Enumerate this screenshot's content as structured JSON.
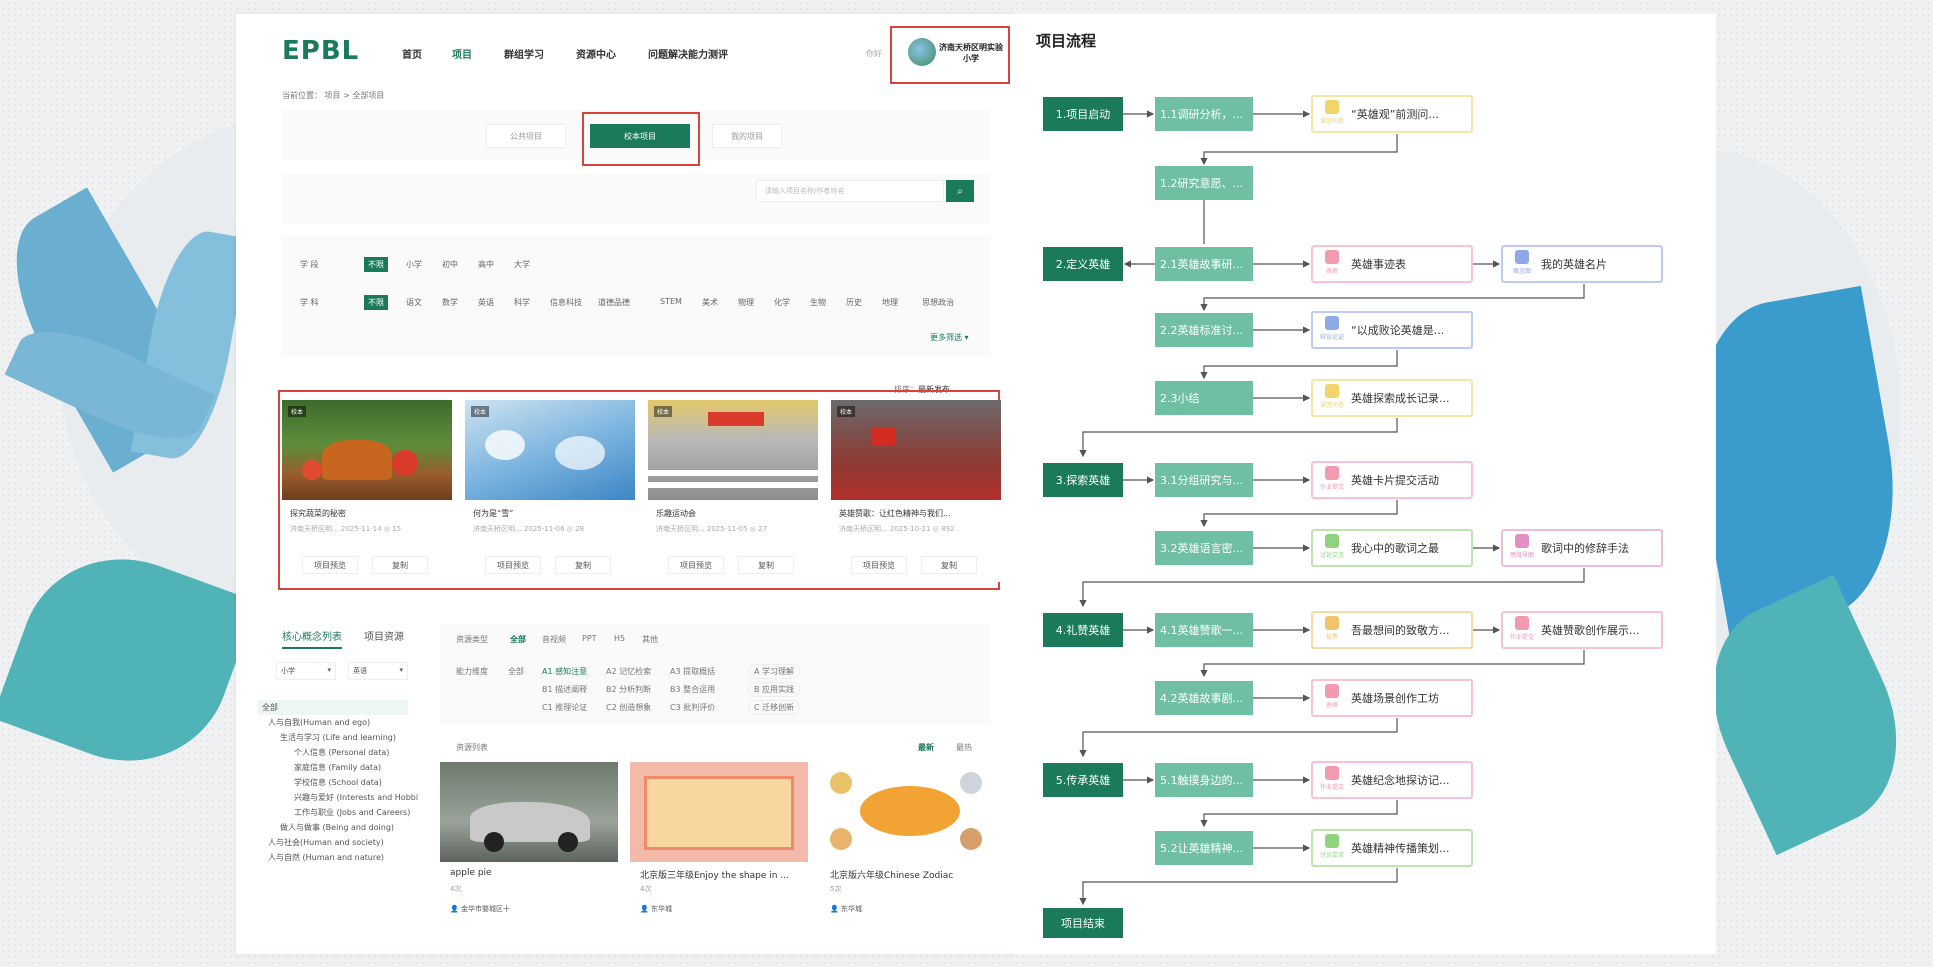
{
  "header": {
    "logo": "EPBL",
    "nav": [
      "首页",
      "项目",
      "群组学习",
      "资源中心",
      "问题解决能力测评"
    ],
    "active_nav": "项目",
    "user_name": "济南天桥区明实验小学",
    "user_prefix": "你好"
  },
  "breadcrumb": "当前位置：  项目  >  全部项目",
  "project_tabs": [
    "公共项目",
    "校本项目",
    "我的项目"
  ],
  "selected_tab": "校本项目",
  "search": {
    "placeholder": "请输入项目名称/作者姓名"
  },
  "filters": {
    "stage_label": "学    段",
    "stage_options": [
      "不限",
      "小学",
      "初中",
      "高中",
      "大学"
    ],
    "subject_label": "学    科",
    "subject_options": [
      "不限",
      "语文",
      "数学",
      "英语",
      "科学",
      "信息科技",
      "道德品德",
      "STEM",
      "美术",
      "物理",
      "化学",
      "生物",
      "历史",
      "地理",
      "思想政治"
    ],
    "more": "更多筛选"
  },
  "sort": {
    "label": "排序：",
    "value": "最新发布"
  },
  "project_cards": [
    {
      "tag": "校本",
      "title": "探究蔬菜的秘密",
      "meta": "济南天桥区明...  2025-11-14  ◎ 15",
      "btn1": "项目预览",
      "btn2": "复制"
    },
    {
      "tag": "校本",
      "title": "何为是“雪”",
      "meta": "济南天桥区明...  2025-11-06  ◎ 28",
      "btn1": "项目预览",
      "btn2": "复制"
    },
    {
      "tag": "校本",
      "title": "乐趣运动会",
      "meta": "济南天桥区明...  2025-11-05  ◎ 27",
      "btn1": "项目预览",
      "btn2": "复制"
    },
    {
      "tag": "校本",
      "title": "英雄赞歌：让红色精神与我们...",
      "meta": "济南天桥区明...  2025-10-21  ◎ 892",
      "btn1": "项目预览",
      "btn2": "复制"
    }
  ],
  "concept_panel": {
    "tabs": [
      "核心概念列表",
      "项目资源"
    ],
    "select1": "小学",
    "select2": "英语",
    "tree": [
      "全部",
      "人与自我(Human and ego)",
      "生活与学习 (Life and learning)",
      "个人信息 (Personal data)",
      "家庭信息 (Family data)",
      "学校信息 (School data)",
      "兴趣与爱好 (Interests and Hobbi",
      "工作与职业 (Jobs and Careers)",
      "做人与做事 (Being and doing)",
      "人与社会(Human and society)",
      "人与自然 (Human and nature)"
    ]
  },
  "resource_panel": {
    "type_label": "资源类型",
    "types": [
      "全部",
      "音视频",
      "PPT",
      "H5",
      "其他"
    ],
    "ability_label": "能力维度",
    "ability_all": "全部",
    "abilities": [
      "A1 感知注意",
      "A2 记忆检索",
      "A3 提取概括",
      "B1 描述阐释",
      "B2 分析判断",
      "B3 整合运用",
      "C1 推理论证",
      "C2 创造想象",
      "C3 批判评价"
    ],
    "ability_groups": [
      "A 学习理解",
      "B 应用实践",
      "C 迁移创新"
    ],
    "list_label": "资源列表",
    "sort_new": "最新",
    "sort_hot": "最热",
    "items": [
      {
        "title": "apple pie",
        "sub": "4次",
        "author": "金华市婺城区十"
      },
      {
        "title": "北京版三年级Enjoy the shape in ...",
        "sub": "4次",
        "author": "东华城"
      },
      {
        "title": "北京版六年级Chinese Zodiac",
        "sub": "5次",
        "author": "东华城"
      }
    ]
  },
  "flow": {
    "title": "项目流程",
    "stages": [
      "1.项目启动",
      "2.定义英雄",
      "3.探索英雄",
      "4.礼赞英雄",
      "5.传承英雄",
      "项目结束"
    ],
    "steps": [
      "1.1调研分析，...",
      "1.2研究意愿、...",
      "2.1英雄故事研...",
      "2.2英雄标准讨...",
      "2.3小结",
      "3.1分组研究与...",
      "3.2英雄语言密...",
      "4.1英雄赞歌一...",
      "4.2英雄故事剧...",
      "5.1触摸身边的...",
      "5.2让英雄精神..."
    ],
    "results": [
      {
        "text": "“英雄观”前测问...",
        "tag": "课堂问卷",
        "color": "#f1d46a"
      },
      {
        "text": "英雄事迹表",
        "tag": "表格",
        "color": "#f29bb0"
      },
      {
        "text": "我的英雄名片",
        "tag": "概念图",
        "color": "#8fa8e8"
      },
      {
        "text": "“以成败论英雄是...",
        "tag": "辩论论证",
        "color": "#8fa8e8"
      },
      {
        "text": "英雄探索成长记录...",
        "tag": "课堂问卷",
        "color": "#f1d46a"
      },
      {
        "text": "英雄卡片提交活动",
        "tag": "作业提交",
        "color": "#f29bb0"
      },
      {
        "text": "我心中的歌词之最",
        "tag": "讨论交流",
        "color": "#8fd37e"
      },
      {
        "text": "歌词中的修辞手法",
        "tag": "思维导图",
        "color": "#e38fc6"
      },
      {
        "text": "吾最想间的致敬方...",
        "tag": "投票",
        "color": "#f1c36a"
      },
      {
        "text": "英雄赞歌创作展示...",
        "tag": "作业提交",
        "color": "#f29bb0"
      },
      {
        "text": "英雄场景创作工坊",
        "tag": "表格",
        "color": "#f29bb0"
      },
      {
        "text": "英雄纪念地探访记...",
        "tag": "作业提交",
        "color": "#f29bb0"
      },
      {
        "text": "英雄精神传播策划...",
        "tag": "讨论交流",
        "color": "#8fd37e"
      }
    ]
  }
}
